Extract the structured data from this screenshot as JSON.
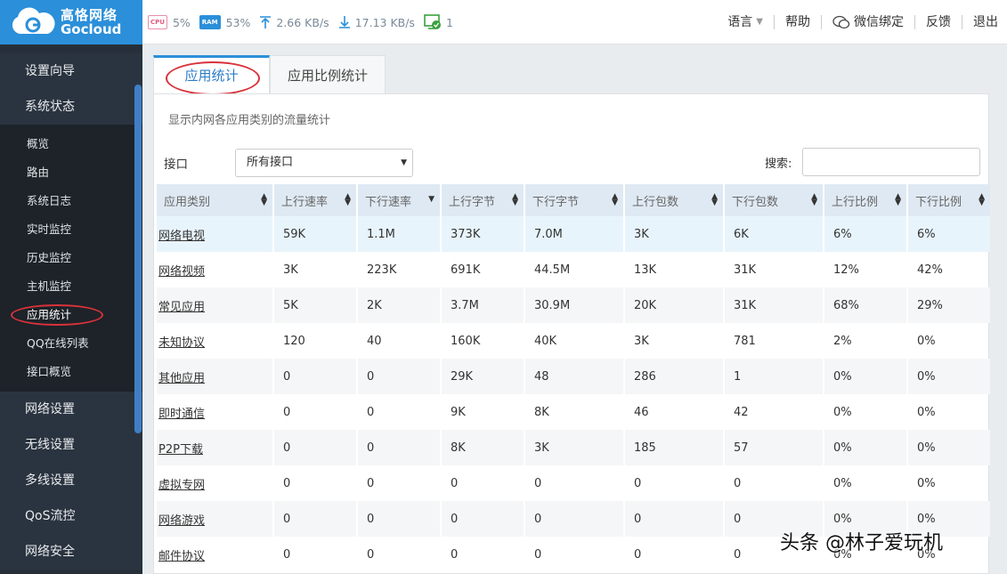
{
  "brand": {
    "cn": "高恪网络",
    "en": "Gocloud"
  },
  "stats": {
    "cpu_chip": "CPU",
    "cpu": "5%",
    "ram_chip": "RAM",
    "ram": "53%",
    "upload": "2.66 KB/s",
    "download": "17.13 KB/s",
    "online": "1"
  },
  "topnav": {
    "language": "语言",
    "help": "帮助",
    "wechat": "微信绑定",
    "feedback": "反馈",
    "logout": "退出"
  },
  "sidebar": {
    "top_items": [
      "设置向导",
      "系统状态"
    ],
    "sub_items": [
      "概览",
      "路由",
      "系统日志",
      "实时监控",
      "历史监控",
      "主机监控",
      "应用统计",
      "QQ在线列表",
      "接口概览"
    ],
    "bottom_items": [
      "网络设置",
      "无线设置",
      "多线设置",
      "QoS流控",
      "网络安全"
    ]
  },
  "tabs": [
    "应用统计",
    "应用比例统计"
  ],
  "description": "显示内网各应用类别的流量统计",
  "filter": {
    "label": "接口",
    "value": "所有接口",
    "search_label": "搜索:"
  },
  "table": {
    "headers": [
      "应用类别",
      "上行速率",
      "下行速率",
      "上行字节",
      "下行字节",
      "上行包数",
      "下行包数",
      "上行比例",
      "下行比例"
    ],
    "rows": [
      [
        "网络电视",
        "59K",
        "1.1M",
        "373K",
        "7.0M",
        "3K",
        "6K",
        "6%",
        "6%"
      ],
      [
        "网络视频",
        "3K",
        "223K",
        "691K",
        "44.5M",
        "13K",
        "31K",
        "12%",
        "42%"
      ],
      [
        "常见应用",
        "5K",
        "2K",
        "3.7M",
        "30.9M",
        "20K",
        "31K",
        "68%",
        "29%"
      ],
      [
        "未知协议",
        "120",
        "40",
        "160K",
        "40K",
        "3K",
        "781",
        "2%",
        "0%"
      ],
      [
        "其他应用",
        "0",
        "0",
        "29K",
        "48",
        "286",
        "1",
        "0%",
        "0%"
      ],
      [
        "即时通信",
        "0",
        "0",
        "9K",
        "8K",
        "46",
        "42",
        "0%",
        "0%"
      ],
      [
        "P2P下载",
        "0",
        "0",
        "8K",
        "3K",
        "185",
        "57",
        "0%",
        "0%"
      ],
      [
        "虚拟专网",
        "0",
        "0",
        "0",
        "0",
        "0",
        "0",
        "0%",
        "0%"
      ],
      [
        "网络游戏",
        "0",
        "0",
        "0",
        "0",
        "0",
        "0",
        "0%",
        "0%"
      ],
      [
        "邮件协议",
        "0",
        "0",
        "0",
        "0",
        "0",
        "0",
        "0%",
        "0%"
      ]
    ]
  },
  "watermark": "头条 @林子爱玩机"
}
